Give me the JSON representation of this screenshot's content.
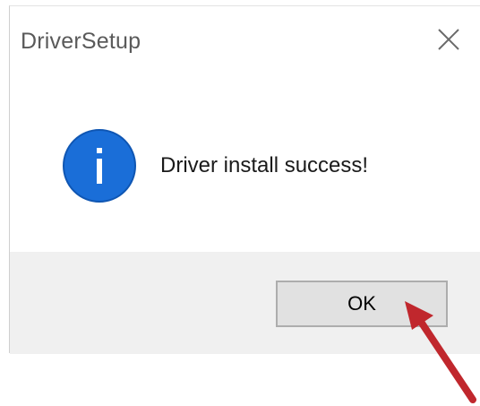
{
  "dialog": {
    "title": "DriverSetup",
    "close_icon": "close-icon",
    "message": "Driver install success!",
    "info_icon": "info-icon",
    "ok_label": "OK"
  },
  "annotation": {
    "arrow_icon": "red-arrow-icon",
    "arrow_color": "#c0272d"
  },
  "colors": {
    "info_blue": "#1a6ed8",
    "footer_bg": "#f0f0f0",
    "button_bg": "#e1e1e1",
    "button_border": "#adadad"
  }
}
